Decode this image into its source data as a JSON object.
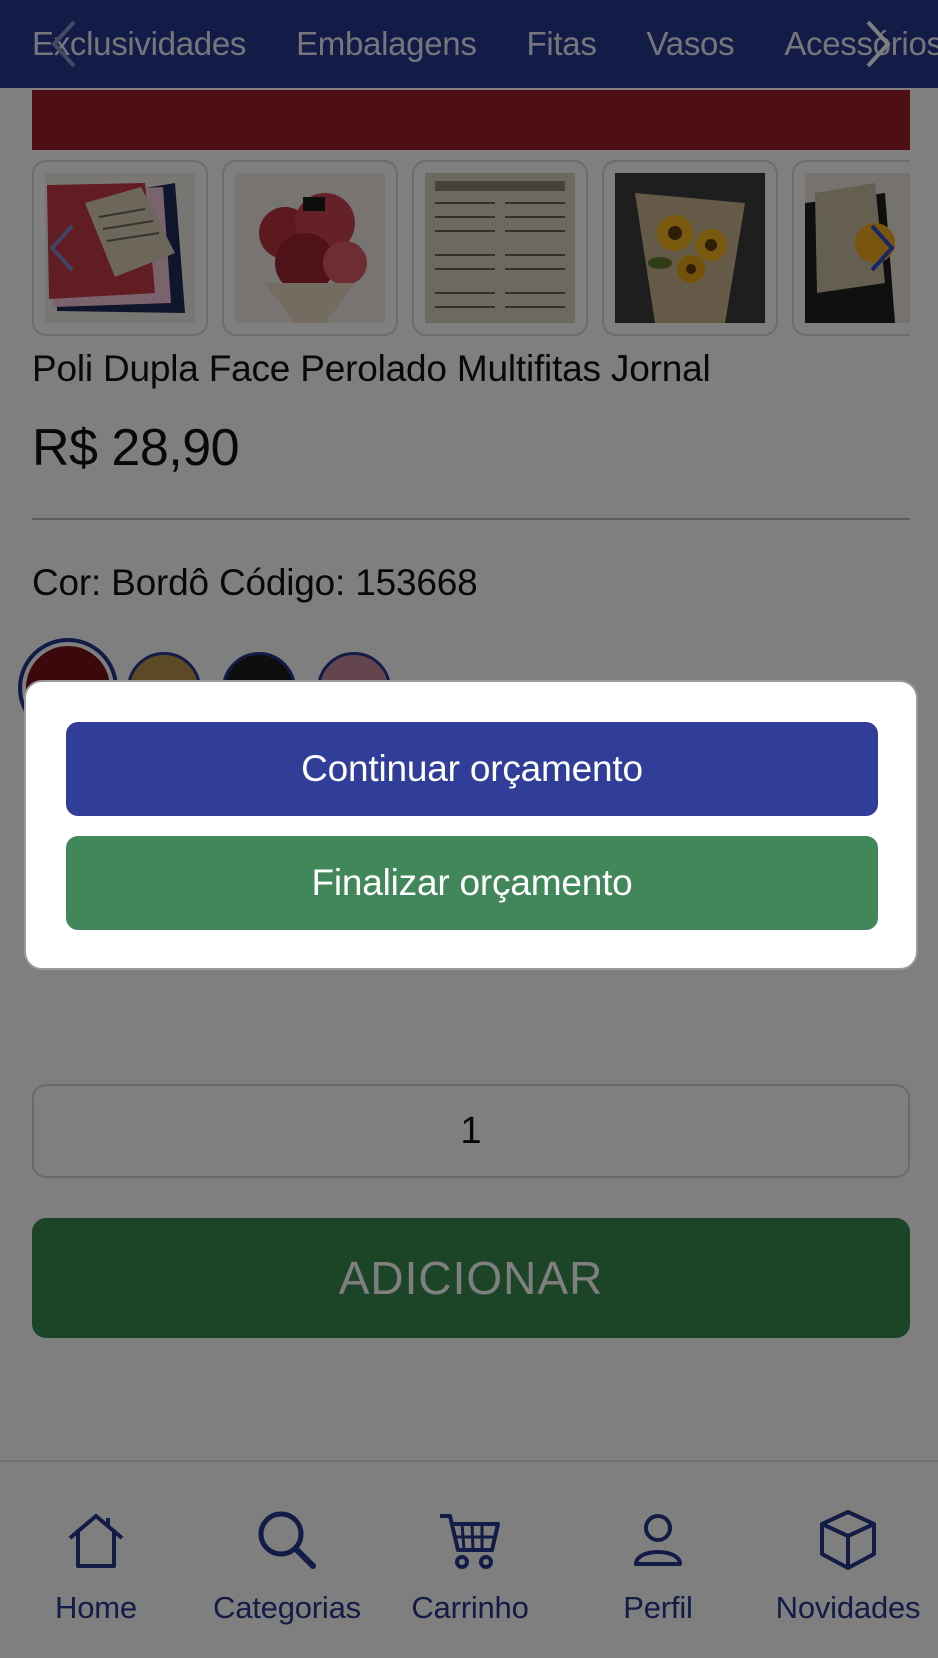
{
  "top_nav": {
    "items": [
      "Exclusividades",
      "Embalagens",
      "Fitas",
      "Vasos",
      "Acessórios"
    ]
  },
  "product": {
    "title": "Poli Dupla Face Perolado Multifitas Jornal",
    "price": "R$ 28,90",
    "color_info": "Cor: Bordô Código: 153668",
    "swatches": [
      {
        "name": "Bordô",
        "color": "#7a1118",
        "selected": true
      },
      {
        "name": "Dourado",
        "color": "#b9954c",
        "selected": false
      },
      {
        "name": "Preto",
        "color": "#1c1c1c",
        "selected": false
      },
      {
        "name": "Rosa",
        "color": "#c98a9c",
        "selected": false
      }
    ],
    "thumbnails": [
      "thumb-paper-colors",
      "thumb-red-bouquet",
      "thumb-newspaper",
      "thumb-sunflower-bouquet",
      "thumb-sunflower-dark"
    ],
    "quantity": "1",
    "add_button_label": "ADICIONAR"
  },
  "dialog": {
    "continue_label": "Continuar orçamento",
    "finish_label": "Finalizar orçamento"
  },
  "bottom_nav": {
    "items": [
      {
        "label": "Home",
        "icon": "home-icon"
      },
      {
        "label": "Categorias",
        "icon": "search-icon"
      },
      {
        "label": "Carrinho",
        "icon": "cart-icon"
      },
      {
        "label": "Perfil",
        "icon": "user-icon"
      },
      {
        "label": "Novidades",
        "icon": "box-icon"
      }
    ]
  },
  "colors": {
    "brand_blue": "#27378e",
    "continue_blue": "#303e9a",
    "finish_green": "#42875a",
    "add_green": "#388a4f",
    "overlay": "rgba(0,0,0,0.5)"
  }
}
